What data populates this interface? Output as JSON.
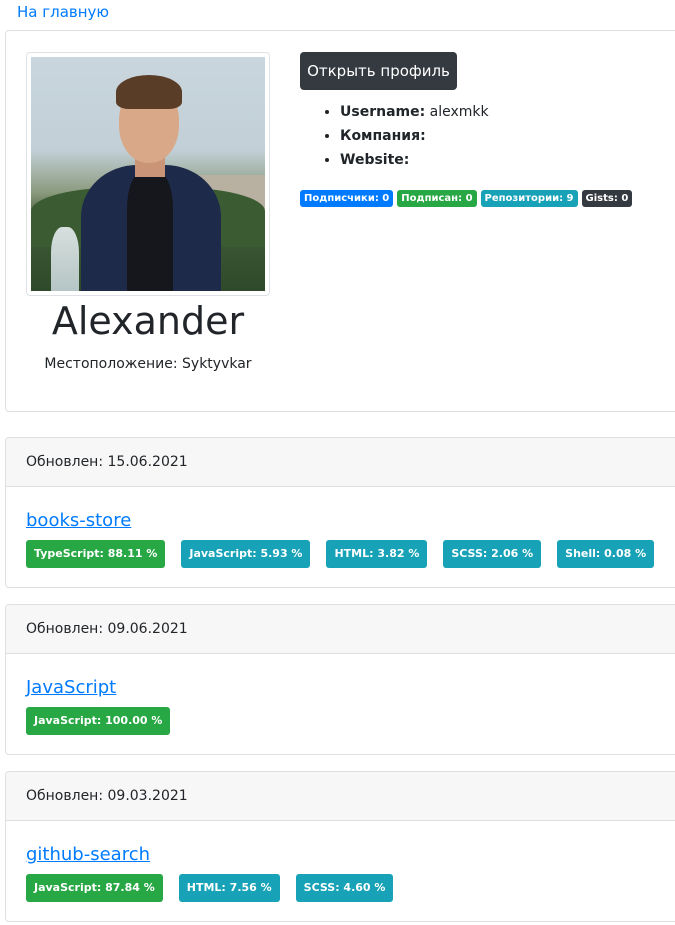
{
  "nav": {
    "home_link": "На главную"
  },
  "profile": {
    "name": "Alexander",
    "location": "Местоположение: Syktyvkar",
    "open_profile_button": "Открыть профиль",
    "info": [
      {
        "label": "Username:",
        "value": " alexmkk"
      },
      {
        "label": "Компания:",
        "value": ""
      },
      {
        "label": "Website:",
        "value": ""
      }
    ],
    "badges": [
      {
        "text": "Подписчики: 0",
        "color": "#007bff"
      },
      {
        "text": "Подписан: 0",
        "color": "#28a745"
      },
      {
        "text": "Репозитории: 9",
        "color": "#17a2b8"
      },
      {
        "text": "Gists: 0",
        "color": "#343a40"
      }
    ]
  },
  "repos": [
    {
      "updated": "Обновлен: 15.06.2021",
      "name": "books-store",
      "languages": [
        {
          "text": "TypeScript: 88.11 %",
          "color": "#28a745"
        },
        {
          "text": "JavaScript: 5.93 %",
          "color": "#17a2b8"
        },
        {
          "text": "HTML: 3.82 %",
          "color": "#17a2b8"
        },
        {
          "text": "SCSS: 2.06 %",
          "color": "#17a2b8"
        },
        {
          "text": "Shell: 0.08 %",
          "color": "#17a2b8"
        }
      ]
    },
    {
      "updated": "Обновлен: 09.06.2021",
      "name": "JavaScript",
      "languages": [
        {
          "text": "JavaScript: 100.00 %",
          "color": "#28a745"
        }
      ]
    },
    {
      "updated": "Обновлен: 09.03.2021",
      "name": "github-search",
      "languages": [
        {
          "text": "JavaScript: 87.84 %",
          "color": "#28a745"
        },
        {
          "text": "HTML: 7.56 %",
          "color": "#17a2b8"
        },
        {
          "text": "SCSS: 4.60 %",
          "color": "#17a2b8"
        }
      ]
    }
  ]
}
